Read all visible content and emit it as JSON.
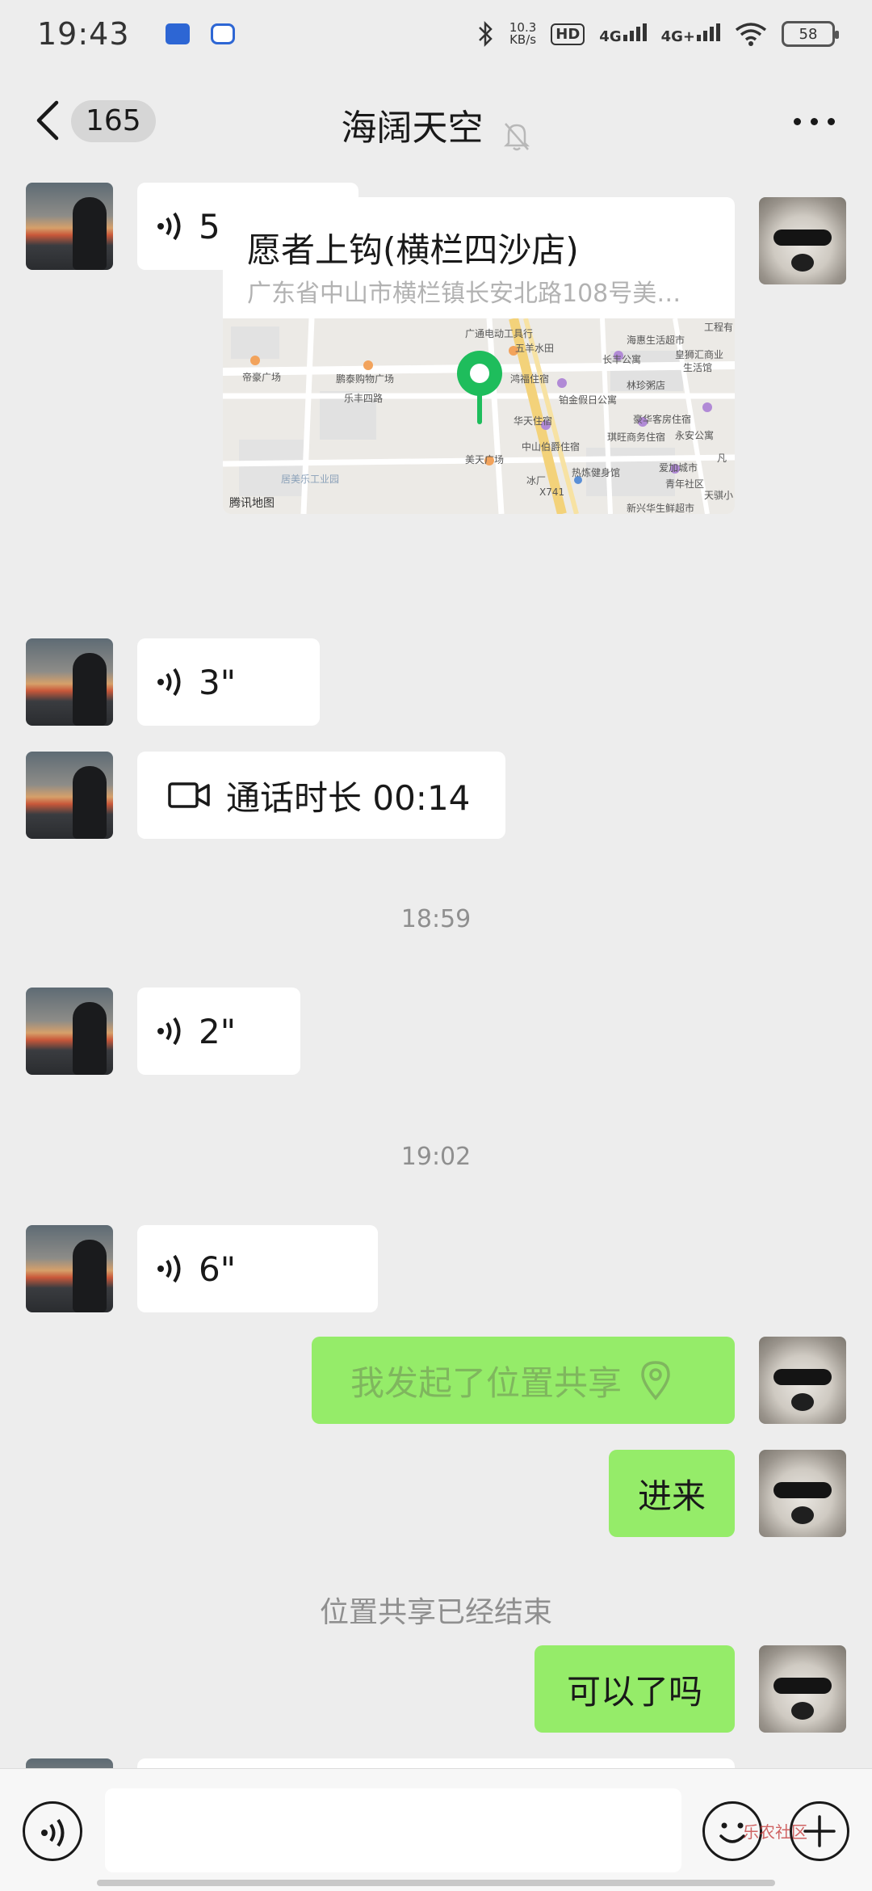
{
  "status_bar": {
    "time": "19:43",
    "net_speed": "10.3",
    "net_unit": "KB/s",
    "hd_label": "HD",
    "signal1": "4G",
    "signal2": "4G+",
    "battery": "58"
  },
  "header": {
    "unread_count": "165",
    "title": "海阔天空"
  },
  "messages": {
    "voice1": "5\"",
    "location_name": "愿者上钩(横栏四沙店)",
    "location_address": "广东省中山市横栏镇长安北路108号美…",
    "map_brand": "腾讯地图",
    "map_labels": [
      "广通电动工具行",
      "五羊水田",
      "海惠生活超市",
      "长丰公寓",
      "皇狮汇商业",
      "生活馆",
      "帝豪广场",
      "鹏泰购物广场",
      "鸿福住宿",
      "林珍粥店",
      "乐丰四路",
      "铂金假日公寓",
      "华天住宿",
      "豪华客房住宿",
      "琪旺商务住宿",
      "永安公寓",
      "中山伯爵住宿",
      "美天广场",
      "热炼健身馆",
      "爱加城市",
      "居美乐工业园",
      "冰厂",
      "X741",
      "新兴华生鲜超市",
      "天骐小",
      "工程有",
      "青年社区",
      "凡"
    ],
    "voice2": "3\"",
    "call_duration": "通话时长 00:14",
    "time1": "18:59",
    "voice3": "2\"",
    "time2": "19:02",
    "voice4": "6\"",
    "location_share": "我发起了位置共享",
    "text_jinlai": "进来",
    "system_ended": "位置共享已经结束",
    "text_keyi": "可以了吗"
  },
  "input": {
    "placeholder": ""
  },
  "watermark": "乐农社区",
  "colors": {
    "background": "#ededed",
    "green_bubble": "#95ec69",
    "map_pin": "#1ebd5c"
  }
}
